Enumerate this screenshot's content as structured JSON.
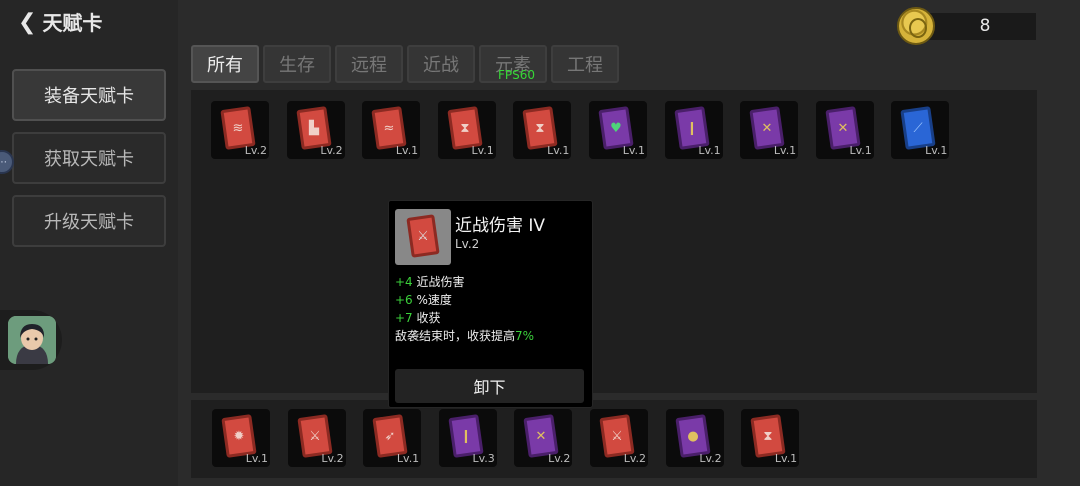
{
  "header": {
    "back_icon": "chevron-left-icon",
    "title": "天赋卡"
  },
  "sidebar": {
    "buttons": [
      "装备天赋卡",
      "获取天赋卡",
      "升级天赋卡"
    ],
    "active_index": 0
  },
  "tabs": [
    "所有",
    "生存",
    "远程",
    "近战",
    "元素",
    "工程"
  ],
  "active_tab": 0,
  "fps": "FPS60",
  "coins": {
    "icon": "coin-icon",
    "value": "8"
  },
  "equipped_cards": [
    {
      "color": "red",
      "icon": "wing-icon",
      "level": "Lv.2"
    },
    {
      "color": "red",
      "icon": "boot-icon",
      "level": "Lv.2"
    },
    {
      "color": "red",
      "icon": "wifi-icon",
      "level": "Lv.1"
    },
    {
      "color": "red",
      "icon": "hourglass-icon",
      "level": "Lv.1"
    },
    {
      "color": "red",
      "icon": "hourglass-icon",
      "level": "Lv.1"
    },
    {
      "color": "purple",
      "icon": "heart-icon",
      "level": "Lv.1"
    },
    {
      "color": "purple",
      "icon": "bullet-icon",
      "level": "Lv.1"
    },
    {
      "color": "purple",
      "icon": "cross-icon",
      "level": "Lv.1"
    },
    {
      "color": "purple",
      "icon": "cross-icon",
      "level": "Lv.1"
    },
    {
      "color": "blue",
      "icon": "blade-icon",
      "level": "Lv.1"
    }
  ],
  "inventory_cards": [
    {
      "color": "red",
      "icon": "gear-icon",
      "level": "Lv.1"
    },
    {
      "color": "red",
      "icon": "sword-icon",
      "level": "Lv.2"
    },
    {
      "color": "red",
      "icon": "arrow-icon",
      "level": "Lv.1"
    },
    {
      "color": "purple",
      "icon": "bullet-icon",
      "level": "Lv.3"
    },
    {
      "color": "purple",
      "icon": "cross-swords-icon",
      "level": "Lv.2"
    },
    {
      "color": "red",
      "icon": "sword-icon",
      "level": "Lv.2"
    },
    {
      "color": "purple",
      "icon": "potion-icon",
      "level": "Lv.2"
    },
    {
      "color": "red",
      "icon": "hourglass-icon",
      "level": "Lv.1"
    }
  ],
  "tooltip": {
    "icon": "sword-icon",
    "title": "近战伤害 IV",
    "level": "Lv.2",
    "stats": [
      {
        "value": "+4",
        "text": "近战伤害"
      },
      {
        "value": "+6",
        "text": "%速度"
      },
      {
        "value": "+7",
        "text": "收获"
      }
    ],
    "effect_text": "敌袭结束时，收获提高",
    "effect_value": "7%",
    "unequip_label": "卸下"
  }
}
